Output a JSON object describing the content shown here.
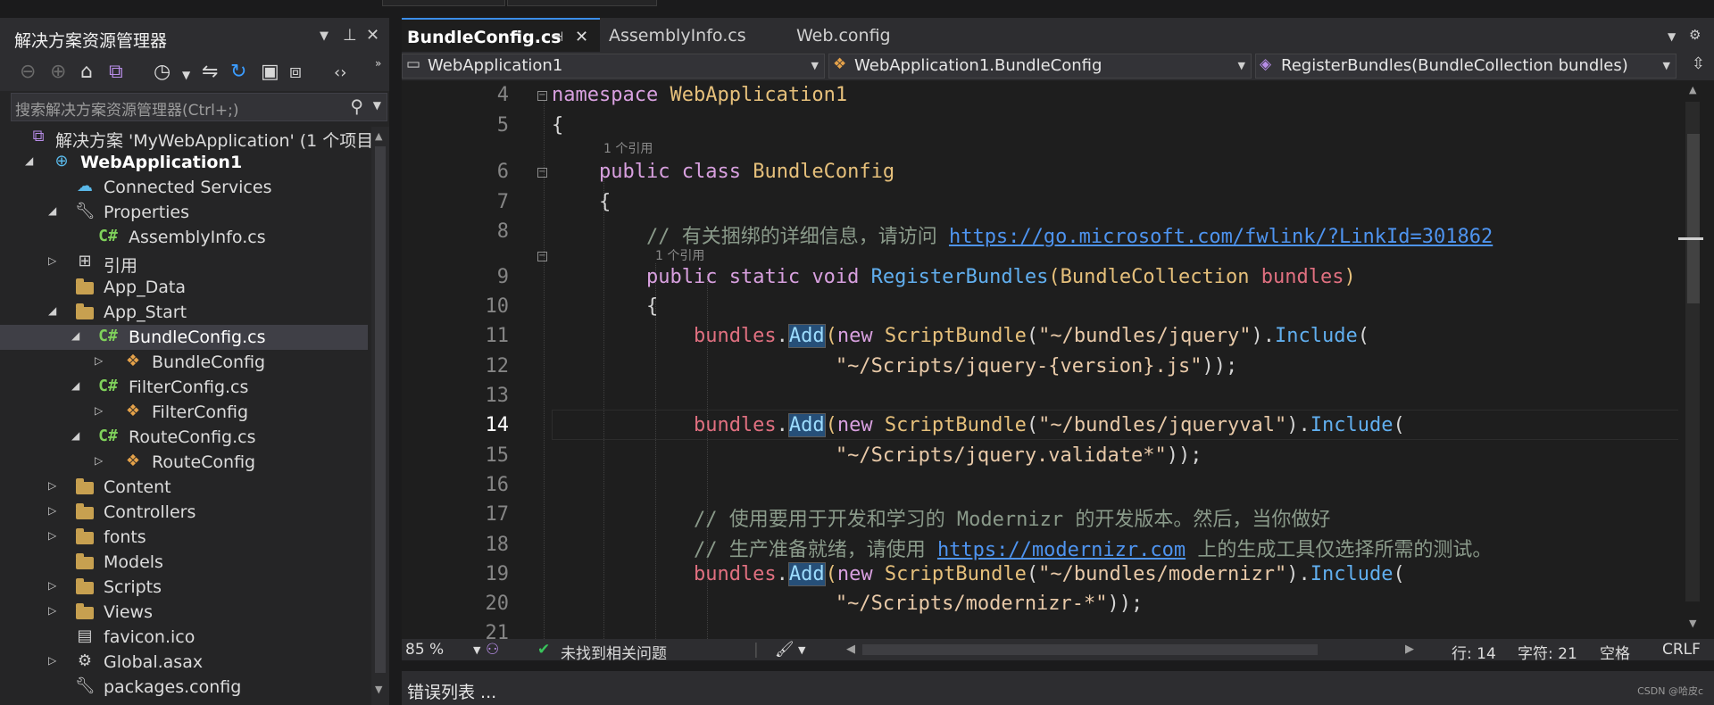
{
  "solution_explorer": {
    "title": "解决方案资源管理器",
    "search_placeholder": "搜索解决方案资源管理器(Ctrl+;)",
    "tree": [
      {
        "label": "解决方案 'MyWebApplication' (1 个项目,",
        "icon": "solution-icon"
      },
      {
        "label": "WebApplication1",
        "icon": "web-project-icon"
      },
      {
        "label": "Connected Services",
        "icon": "connected-services-icon"
      },
      {
        "label": "Properties",
        "icon": "wrench-icon"
      },
      {
        "label": "AssemblyInfo.cs",
        "icon": "csharp-file-icon"
      },
      {
        "label": "引用",
        "icon": "references-icon"
      },
      {
        "label": "App_Data",
        "icon": "folder-icon"
      },
      {
        "label": "App_Start",
        "icon": "folder-icon"
      },
      {
        "label": "BundleConfig.cs",
        "icon": "csharp-file-icon"
      },
      {
        "label": "BundleConfig",
        "icon": "class-icon"
      },
      {
        "label": "FilterConfig.cs",
        "icon": "csharp-file-icon"
      },
      {
        "label": "FilterConfig",
        "icon": "class-icon"
      },
      {
        "label": "RouteConfig.cs",
        "icon": "csharp-file-icon"
      },
      {
        "label": "RouteConfig",
        "icon": "class-icon"
      },
      {
        "label": "Content",
        "icon": "folder-icon"
      },
      {
        "label": "Controllers",
        "icon": "folder-icon"
      },
      {
        "label": "fonts",
        "icon": "folder-icon"
      },
      {
        "label": "Models",
        "icon": "folder-icon"
      },
      {
        "label": "Scripts",
        "icon": "folder-icon"
      },
      {
        "label": "Views",
        "icon": "folder-icon"
      },
      {
        "label": "favicon.ico",
        "icon": "icon-file-icon"
      },
      {
        "label": "Global.asax",
        "icon": "global-asax-icon"
      },
      {
        "label": "packages.config",
        "icon": "config-file-icon"
      }
    ]
  },
  "editor": {
    "tabs": [
      {
        "label": "BundleConfig.cs",
        "active": true
      },
      {
        "label": "AssemblyInfo.cs",
        "active": false
      },
      {
        "label": "Web.config",
        "active": false
      }
    ],
    "nav": {
      "project": "WebApplication1",
      "type": "WebApplication1.BundleConfig",
      "member": "RegisterBundles(BundleCollection bundles)"
    },
    "line_numbers": [
      "4",
      "5",
      "6",
      "7",
      "8",
      "9",
      "10",
      "11",
      "12",
      "13",
      "14",
      "15",
      "16",
      "17",
      "18",
      "19",
      "20",
      "21"
    ],
    "current_line": "14",
    "references_label": "1 个引用",
    "code": {
      "l4_kw": "namespace",
      "l4_name": "WebApplication1",
      "brace_open": "{",
      "l6_kw1": "public",
      "l6_kw2": "class",
      "l6_name": "BundleConfig",
      "l8_comment": "// 有关捆绑的详细信息，请访问 ",
      "l8_url": "https://go.microsoft.com/fwlink/?LinkId=301862",
      "l9_kw1": "public",
      "l9_kw2": "static",
      "l9_kw3": "void",
      "l9_method": "RegisterBundles",
      "l9_paren_open": "(",
      "l9_type": "BundleCollection",
      "l9_param": "bundles",
      "l9_paren_close": ")",
      "bundles": "bundles",
      "dot": ".",
      "add": "Add",
      "paren_open": "(",
      "new_kw": "new",
      "script_bundle": "ScriptBundle",
      "l11_str": "\"~/bundles/jquery\"",
      "close_paren_dot": ").",
      "include": "Include",
      "l12_str": "\"~/Scripts/jquery-{version}.js\"",
      "close_all": "));",
      "l14_str": "\"~/bundles/jqueryval\"",
      "l15_str": "\"~/Scripts/jquery.validate*\"",
      "l17_comment": "// 使用要用于开发和学习的 Modernizr 的开发版本。然后，当你做好",
      "l18_comment": "// 生产准备就绪，请使用 ",
      "l18_url": "https://modernizr.com",
      "l18_comment2": " 上的生成工具仅选择所需的测试。",
      "l19_str": "\"~/bundles/modernizr\"",
      "l20_str": "\"~/Scripts/modernizr-*\""
    }
  },
  "statusbar": {
    "zoom": "85 %",
    "issues": "未找到相关问题",
    "line": "行: 14",
    "char": "字符: 21",
    "spaces": "空格",
    "eol": "CRLF"
  },
  "bottom": {
    "error_list": "错误列表 ...",
    "watermark": "CSDN @哈皮c"
  }
}
